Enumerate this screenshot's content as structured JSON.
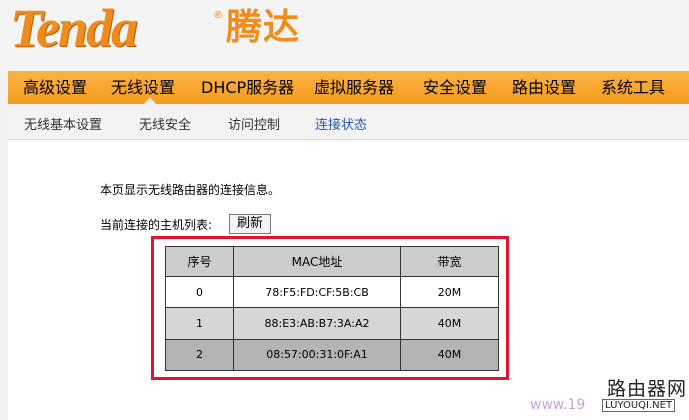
{
  "brand": {
    "logo_text": "Tenda",
    "logo_registered": "®",
    "logo_cn": "腾达"
  },
  "main_nav": {
    "items": [
      "高级设置",
      "无线设置",
      "DHCP服务器",
      "虚拟服务器",
      "安全设置",
      "路由设置",
      "系统工具"
    ],
    "active": "无线设置"
  },
  "sub_nav": {
    "items": [
      "无线基本设置",
      "无线安全",
      "访问控制",
      "连接状态"
    ],
    "active": "连接状态"
  },
  "content": {
    "info_text": "本页显示无线路由器的连接信息。",
    "host_list_label": "当前连接的主机列表:",
    "refresh_label": "刷新"
  },
  "host_table": {
    "headers": [
      "序号",
      "MAC地址",
      "带宽"
    ],
    "rows": [
      [
        "0",
        "78:F5:FD:CF:5B:CB",
        "20M"
      ],
      [
        "1",
        "88:E3:AB:B7:3A:A2",
        "40M"
      ],
      [
        "2",
        "08:57:00:31:0F:A1",
        "40M"
      ]
    ]
  },
  "watermark": {
    "cn": "路由器网",
    "en": "www.19",
    "tag": "LUYOUQI.NET"
  },
  "colors": {
    "brand_orange": "#f08c1c",
    "nav_orange": "#f49b1e",
    "highlight_red": "#e8112d",
    "active_link": "#2b55a8"
  }
}
